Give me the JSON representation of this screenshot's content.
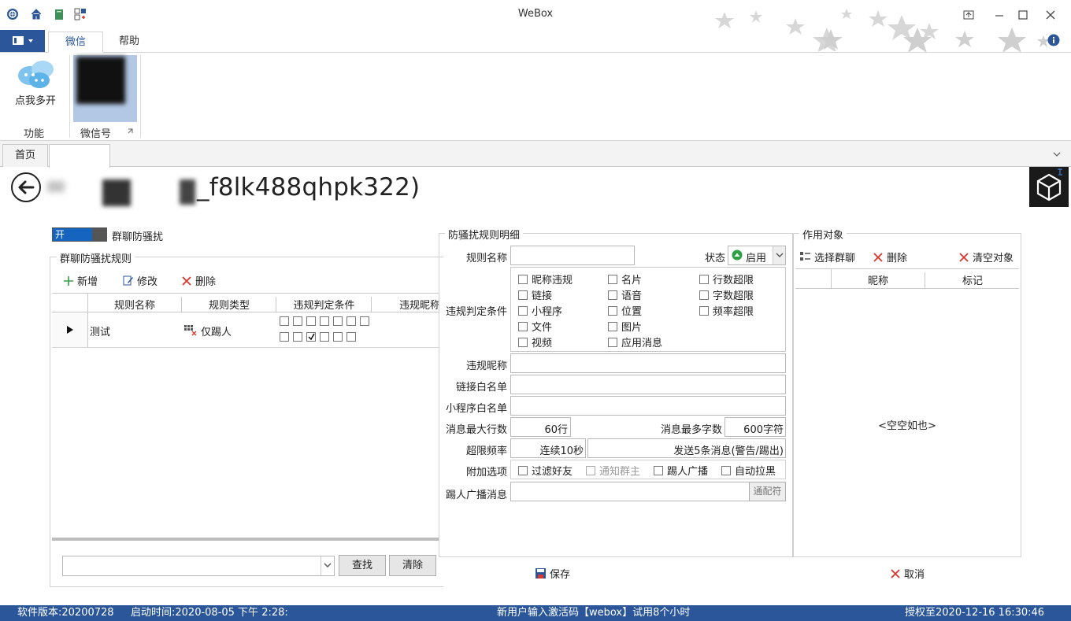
{
  "app": {
    "title": "WeBox"
  },
  "ribbon": {
    "tabs": [
      {
        "label": "微信"
      },
      {
        "label": "帮助"
      }
    ],
    "multi_open_label": "点我多开",
    "group_function": "功能",
    "group_account": "微信号"
  },
  "doc_tabs": [
    {
      "label": "首页"
    },
    {
      "label": ""
    }
  ],
  "page": {
    "title": "_f8lk488qhpk322)"
  },
  "left": {
    "toggle_label": "开",
    "toggle_caption": "群聊防骚扰",
    "rules_legend": "群聊防骚扰规则",
    "toolbar": {
      "add": "新增",
      "edit": "修改",
      "delete": "删除"
    },
    "table": {
      "headers": [
        "规则名称",
        "规则类型",
        "违规判定条件",
        "违规昵称"
      ],
      "rows": [
        {
          "name": "测试",
          "type": "仅踢人"
        }
      ]
    },
    "search_value": "",
    "find_btn": "查找",
    "clear_btn": "清除"
  },
  "detail": {
    "legend": "防骚扰规则明细",
    "rule_name_label": "规则名称",
    "rule_name_value": "",
    "status_label": "状态",
    "status_value": "启用",
    "condition_label": "违规判定条件",
    "conditions": [
      {
        "label": "昵称违规",
        "checked": false
      },
      {
        "label": "名片",
        "checked": false
      },
      {
        "label": "行数超限",
        "checked": false
      },
      {
        "label": "链接",
        "checked": false
      },
      {
        "label": "语音",
        "checked": false
      },
      {
        "label": "字数超限",
        "checked": false
      },
      {
        "label": "小程序",
        "checked": false
      },
      {
        "label": "位置",
        "checked": false
      },
      {
        "label": "频率超限",
        "checked": false
      },
      {
        "label": "文件",
        "checked": false
      },
      {
        "label": "图片",
        "checked": false
      },
      {
        "label": "视频",
        "checked": false
      },
      {
        "label": "应用消息",
        "checked": false
      }
    ],
    "nickname_label": "违规昵称",
    "link_whitelist_label": "链接白名单",
    "miniapp_whitelist_label": "小程序白名单",
    "max_lines_label": "消息最大行数",
    "max_lines_value": "60行",
    "max_chars_label": "消息最多字数",
    "max_chars_value": "600字符",
    "freq_label": "超限频率",
    "freq_value": "连续10秒",
    "freq_desc": "发送5条消息(警告/踢出)",
    "extra_label": "附加选项",
    "extra": [
      {
        "label": "过滤好友",
        "enabled": true
      },
      {
        "label": "通知群主",
        "enabled": false
      },
      {
        "label": "踢人广播",
        "enabled": true
      },
      {
        "label": "自动拉黑",
        "enabled": true
      }
    ],
    "kick_msg_label": "踢人广播消息",
    "wildcard_btn": "通配符",
    "save_btn": "保存"
  },
  "target": {
    "legend": "作用对象",
    "select_group": "选择群聊",
    "delete": "删除",
    "clear": "清空对象",
    "headers": [
      "",
      "昵称",
      "标记"
    ],
    "empty": "<空空如也>",
    "cancel_btn": "取消"
  },
  "status": {
    "version": "软件版本:20200728",
    "start_time": "启动时间:2020-08-05 下午 2:28:",
    "promo": "新用户输入激活码【webox】试用8个小时",
    "license": "授权至2020-12-16 16:30:46"
  },
  "colors": {
    "accent": "#2b579a",
    "delete_red": "#d9372b",
    "status_green": "#2ea043"
  }
}
